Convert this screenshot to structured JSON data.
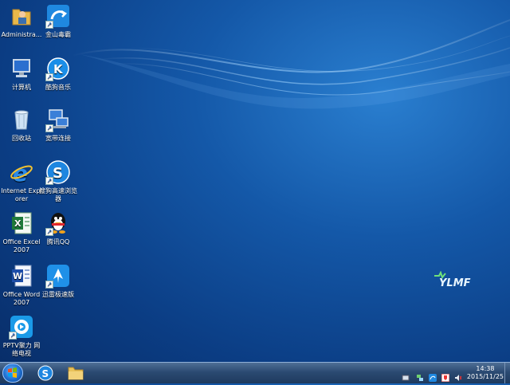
{
  "desktop": {
    "icons": [
      {
        "label": "Administra...",
        "icon": "user-folder-icon"
      },
      {
        "label": "金山毒霸",
        "icon": "kingsoft-antivirus-icon"
      },
      {
        "label": "计算机",
        "icon": "computer-icon"
      },
      {
        "label": "酷狗音乐",
        "icon": "kugou-music-icon"
      },
      {
        "label": "回收站",
        "icon": "recycle-bin-icon"
      },
      {
        "label": "宽带连接",
        "icon": "broadband-connection-icon"
      },
      {
        "label": "Internet Explorer",
        "icon": "internet-explorer-icon"
      },
      {
        "label": "搜狗高速浏览器",
        "icon": "sogou-browser-icon"
      },
      {
        "label": "Office Excel 2007",
        "icon": "excel-icon"
      },
      {
        "label": "腾讯QQ",
        "icon": "qq-icon"
      },
      {
        "label": "Office Word 2007",
        "icon": "word-icon"
      },
      {
        "label": "迅雷极速版",
        "icon": "thunder-icon"
      },
      {
        "label": "PPTV聚力 网络电视",
        "icon": "pptv-icon"
      }
    ],
    "wallpaper_logo": "YLMF"
  },
  "taskbar": {
    "start_icon": "windows-start-icon",
    "pinned": [
      {
        "icon": "sogou-browser-icon"
      },
      {
        "icon": "file-explorer-icon"
      }
    ],
    "tray": [
      {
        "icon": "keyboard-icon"
      },
      {
        "icon": "network-icon"
      },
      {
        "icon": "kingsoft-antivirus-tray-icon"
      },
      {
        "icon": "security-shield-icon"
      },
      {
        "icon": "speaker-icon"
      }
    ],
    "clock": {
      "time": "14:38",
      "date": "2015/11/25"
    }
  },
  "colors": {
    "wallpaper": "#0b3d84",
    "taskbar": "#2b4a72"
  }
}
